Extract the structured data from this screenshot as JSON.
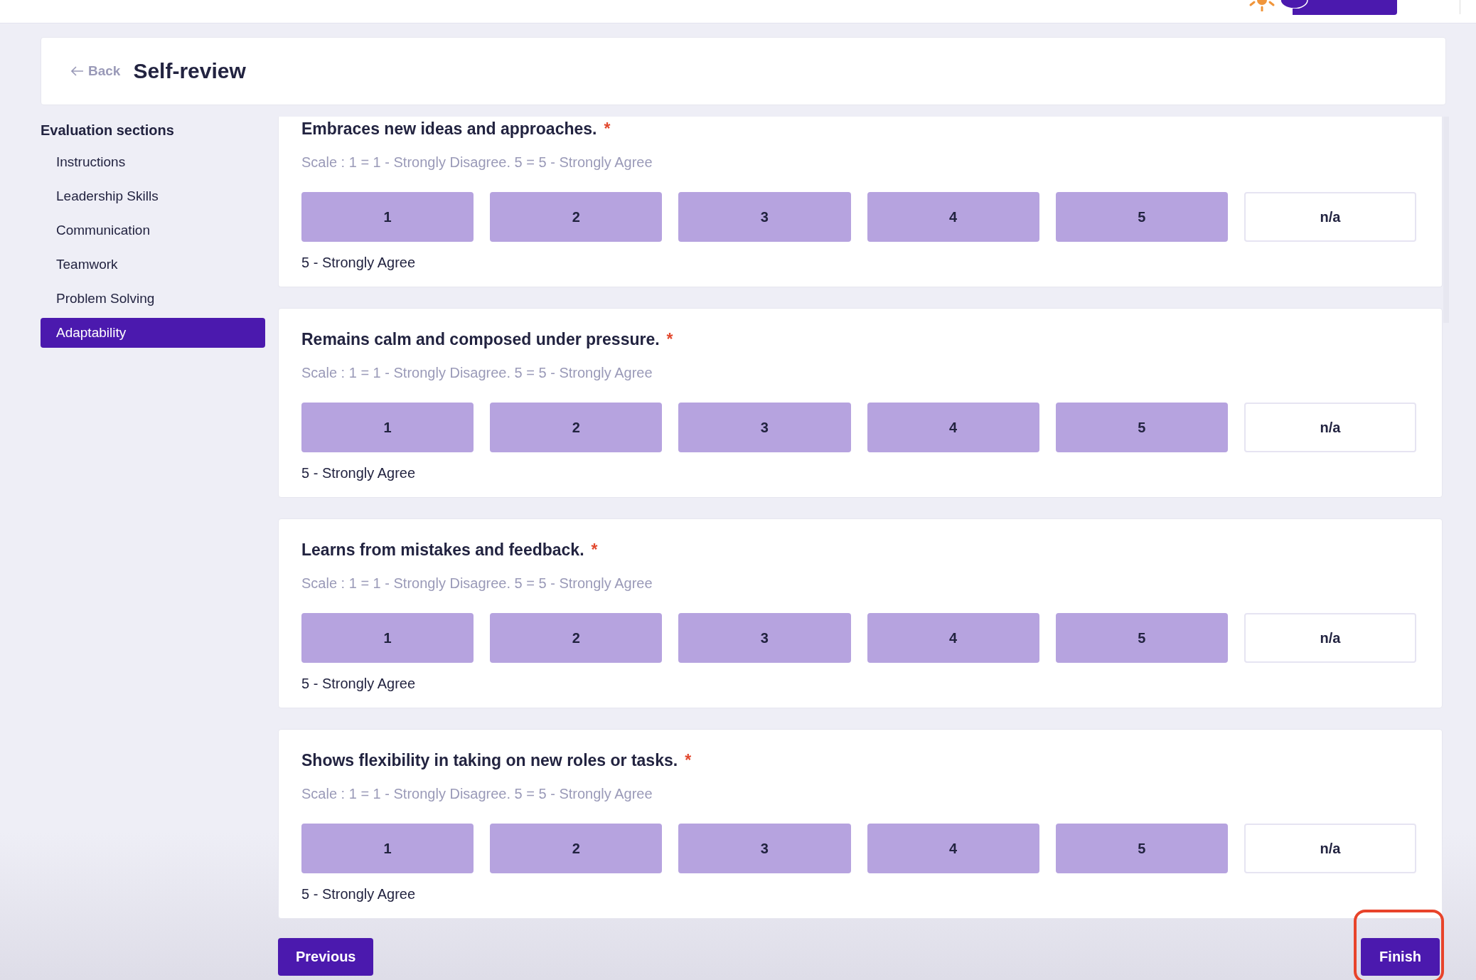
{
  "header": {
    "back": "Back",
    "title": "Self-review"
  },
  "sidebar": {
    "title": "Evaluation sections",
    "items": [
      {
        "label": "Instructions",
        "selected": false
      },
      {
        "label": "Leadership Skills",
        "selected": false
      },
      {
        "label": "Communication",
        "selected": false
      },
      {
        "label": "Teamwork",
        "selected": false
      },
      {
        "label": "Problem Solving",
        "selected": false
      },
      {
        "label": "Adaptability",
        "selected": true
      }
    ]
  },
  "questions": [
    {
      "title": "Embraces new ideas and approaches.",
      "required": "*",
      "scale": "Scale : 1 = 1 - Strongly Disagree. 5 = 5 - Strongly Agree",
      "options": [
        {
          "label": "1",
          "selected": true
        },
        {
          "label": "2",
          "selected": true
        },
        {
          "label": "3",
          "selected": true
        },
        {
          "label": "4",
          "selected": true
        },
        {
          "label": "5",
          "selected": true
        },
        {
          "label": "n/a",
          "selected": false
        }
      ],
      "answer": "5 - Strongly Agree"
    },
    {
      "title": "Remains calm and composed under pressure.",
      "required": "*",
      "scale": "Scale : 1 = 1 - Strongly Disagree. 5 = 5 - Strongly Agree",
      "options": [
        {
          "label": "1",
          "selected": true
        },
        {
          "label": "2",
          "selected": true
        },
        {
          "label": "3",
          "selected": true
        },
        {
          "label": "4",
          "selected": true
        },
        {
          "label": "5",
          "selected": true
        },
        {
          "label": "n/a",
          "selected": false
        }
      ],
      "answer": "5 - Strongly Agree"
    },
    {
      "title": "Learns from mistakes and feedback.",
      "required": "*",
      "scale": "Scale : 1 = 1 - Strongly Disagree. 5 = 5 - Strongly Agree",
      "options": [
        {
          "label": "1",
          "selected": true
        },
        {
          "label": "2",
          "selected": true
        },
        {
          "label": "3",
          "selected": true
        },
        {
          "label": "4",
          "selected": true
        },
        {
          "label": "5",
          "selected": true
        },
        {
          "label": "n/a",
          "selected": false
        }
      ],
      "answer": "5 - Strongly Agree"
    },
    {
      "title": "Shows flexibility in taking on new roles or tasks.",
      "required": "*",
      "scale": "Scale : 1 = 1 - Strongly Disagree. 5 = 5 - Strongly Agree",
      "options": [
        {
          "label": "1",
          "selected": true
        },
        {
          "label": "2",
          "selected": true
        },
        {
          "label": "3",
          "selected": true
        },
        {
          "label": "4",
          "selected": true
        },
        {
          "label": "5",
          "selected": true
        },
        {
          "label": "n/a",
          "selected": false
        }
      ],
      "answer": "5 - Strongly Agree"
    }
  ],
  "footer": {
    "previous": "Previous",
    "finish": "Finish"
  }
}
